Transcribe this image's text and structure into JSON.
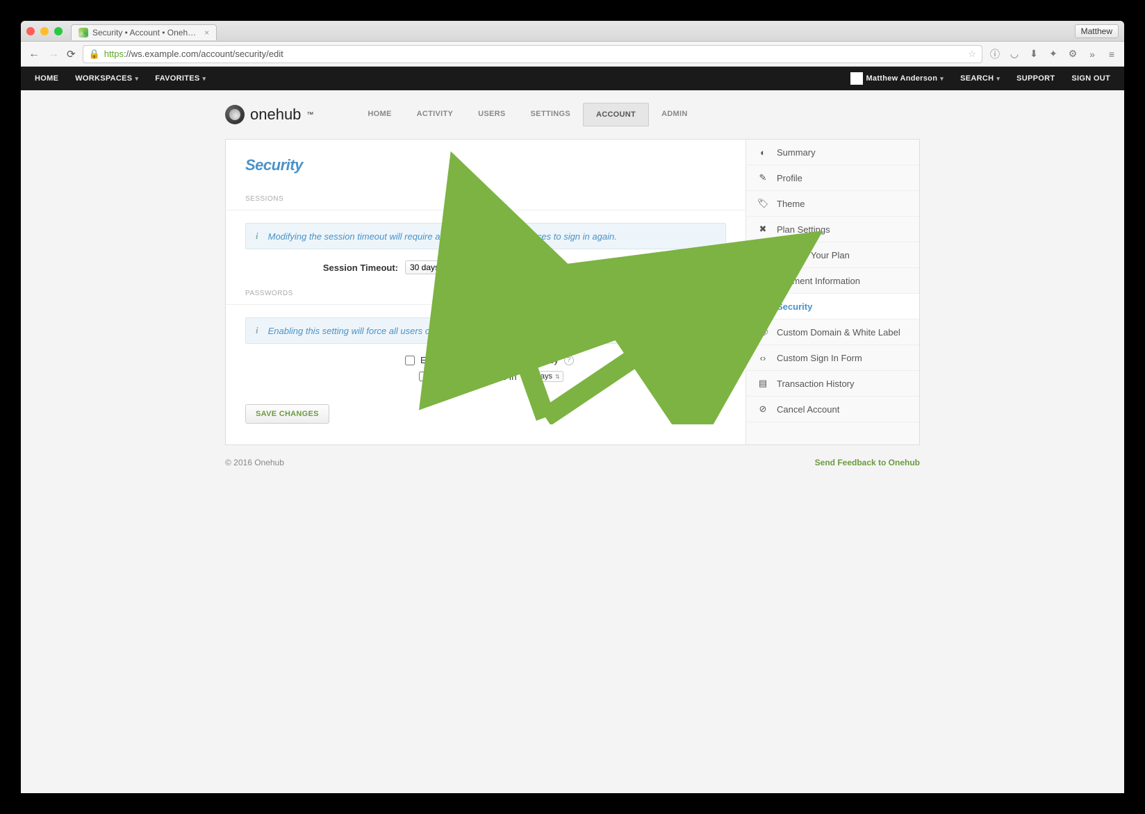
{
  "browser": {
    "tab_title": "Security • Account • Oneh…",
    "profile_button": "Matthew",
    "url_https": "https",
    "url_rest": "://ws.example.com/account/security/edit"
  },
  "topbar": {
    "home": "HOME",
    "workspaces": "WORKSPACES",
    "favorites": "FAVORITES",
    "user_name": "Matthew Anderson",
    "search": "SEARCH",
    "support": "SUPPORT",
    "sign_out": "SIGN OUT"
  },
  "brand": "onehub",
  "main_nav": {
    "home": "HOME",
    "activity": "ACTIVITY",
    "users": "USERS",
    "settings": "SETTINGS",
    "account": "ACCOUNT",
    "admin": "ADMIN"
  },
  "page_title": "Security",
  "sessions": {
    "section_label": "SESSIONS",
    "info": "Modifying the session timeout will require all users of your Workspaces to sign in again.",
    "timeout_label": "Session Timeout:",
    "timeout_value": "30 days"
  },
  "passwords": {
    "section_label": "PASSWORDS",
    "info": "Enabling this setting will force all users of your Workspaces to change their password the next time they sign in.",
    "enforce_label": "Enforce Complex Password Policy",
    "expires_label": "Password Expires In",
    "expires_value": "90 days"
  },
  "save_label": "SAVE CHANGES",
  "sidebar": {
    "items": [
      {
        "label": "Summary"
      },
      {
        "label": "Profile"
      },
      {
        "label": "Theme"
      },
      {
        "label": "Plan Settings"
      },
      {
        "label": "Change Your Plan"
      },
      {
        "label": "Payment Information"
      },
      {
        "label": "Security"
      },
      {
        "label": "Custom Domain & White Label"
      },
      {
        "label": "Custom Sign In Form"
      },
      {
        "label": "Transaction History"
      },
      {
        "label": "Cancel Account"
      }
    ]
  },
  "footer": {
    "copyright": "© 2016 Onehub",
    "feedback": "Send Feedback to Onehub"
  }
}
